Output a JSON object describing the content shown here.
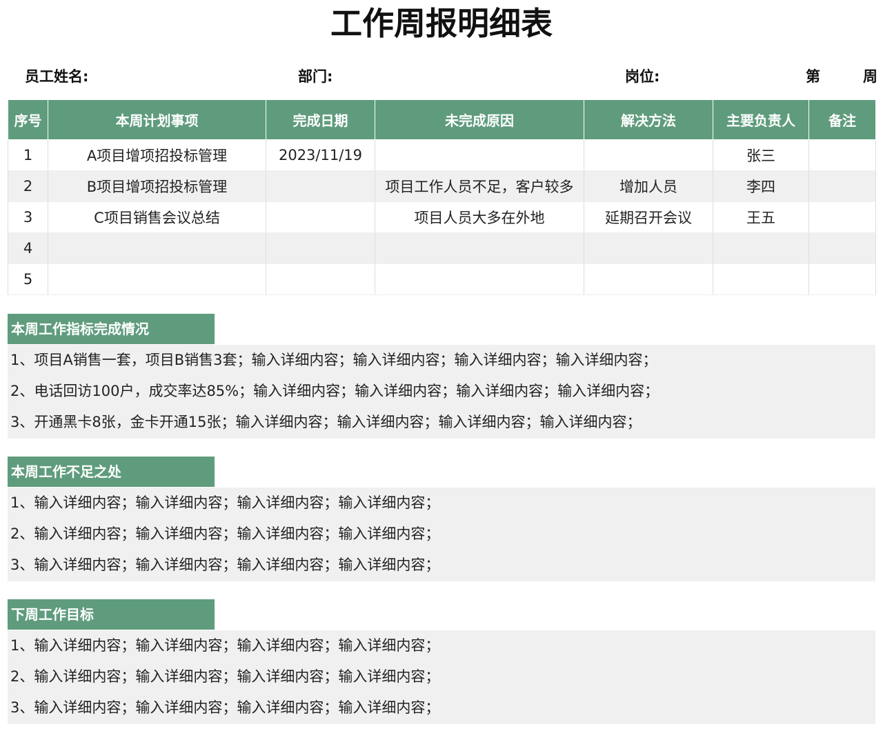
{
  "title": "工作周报明细表",
  "info": {
    "name_label": "员工姓名:",
    "dept_label": "部门:",
    "post_label": "岗位:",
    "week_prefix": "第",
    "week_suffix": "周"
  },
  "table": {
    "headers": [
      "序号",
      "本周计划事项",
      "完成日期",
      "未完成原因",
      "解决方法",
      "主要负责人",
      "备注"
    ],
    "rows": [
      [
        "1",
        "A项目增项招投标管理",
        "2023/11/19",
        "",
        "",
        "张三",
        ""
      ],
      [
        "2",
        "B项目增项招投标管理",
        "",
        "项目工作人员不足，客户较多",
        "增加人员",
        "李四",
        ""
      ],
      [
        "3",
        "C项目销售会议总结",
        "",
        "项目人员大多在外地",
        "延期召开会议",
        "王五",
        ""
      ],
      [
        "4",
        "",
        "",
        "",
        "",
        "",
        ""
      ],
      [
        "5",
        "",
        "",
        "",
        "",
        "",
        ""
      ]
    ]
  },
  "sections": [
    {
      "heading": "本周工作指标完成情况",
      "lines": [
        "1、项目A销售一套，项目B销售3套；输入详细内容；输入详细内容；输入详细内容；输入详细内容；",
        "2、电话回访100户，成交率达85%；输入详细内容；输入详细内容；输入详细内容；输入详细内容；",
        "3、开通黑卡8张，金卡开通15张；输入详细内容；输入详细内容；输入详细内容；输入详细内容；"
      ]
    },
    {
      "heading": "本周工作不足之处",
      "lines": [
        "1、输入详细内容；输入详细内容；输入详细内容；输入详细内容；",
        "2、输入详细内容；输入详细内容；输入详细内容；输入详细内容；",
        "3、输入详细内容；输入详细内容；输入详细内容；输入详细内容；"
      ]
    },
    {
      "heading": "下周工作目标",
      "lines": [
        "1、输入详细内容；输入详细内容；输入详细内容；输入详细内容；",
        "2、输入详细内容；输入详细内容；输入详细内容；输入详细内容；",
        "3、输入详细内容；输入详细内容；输入详细内容；输入详细内容；"
      ]
    }
  ],
  "colors": {
    "header_green": "#5f9c7d",
    "stripe_gray": "#f0f0f0"
  }
}
